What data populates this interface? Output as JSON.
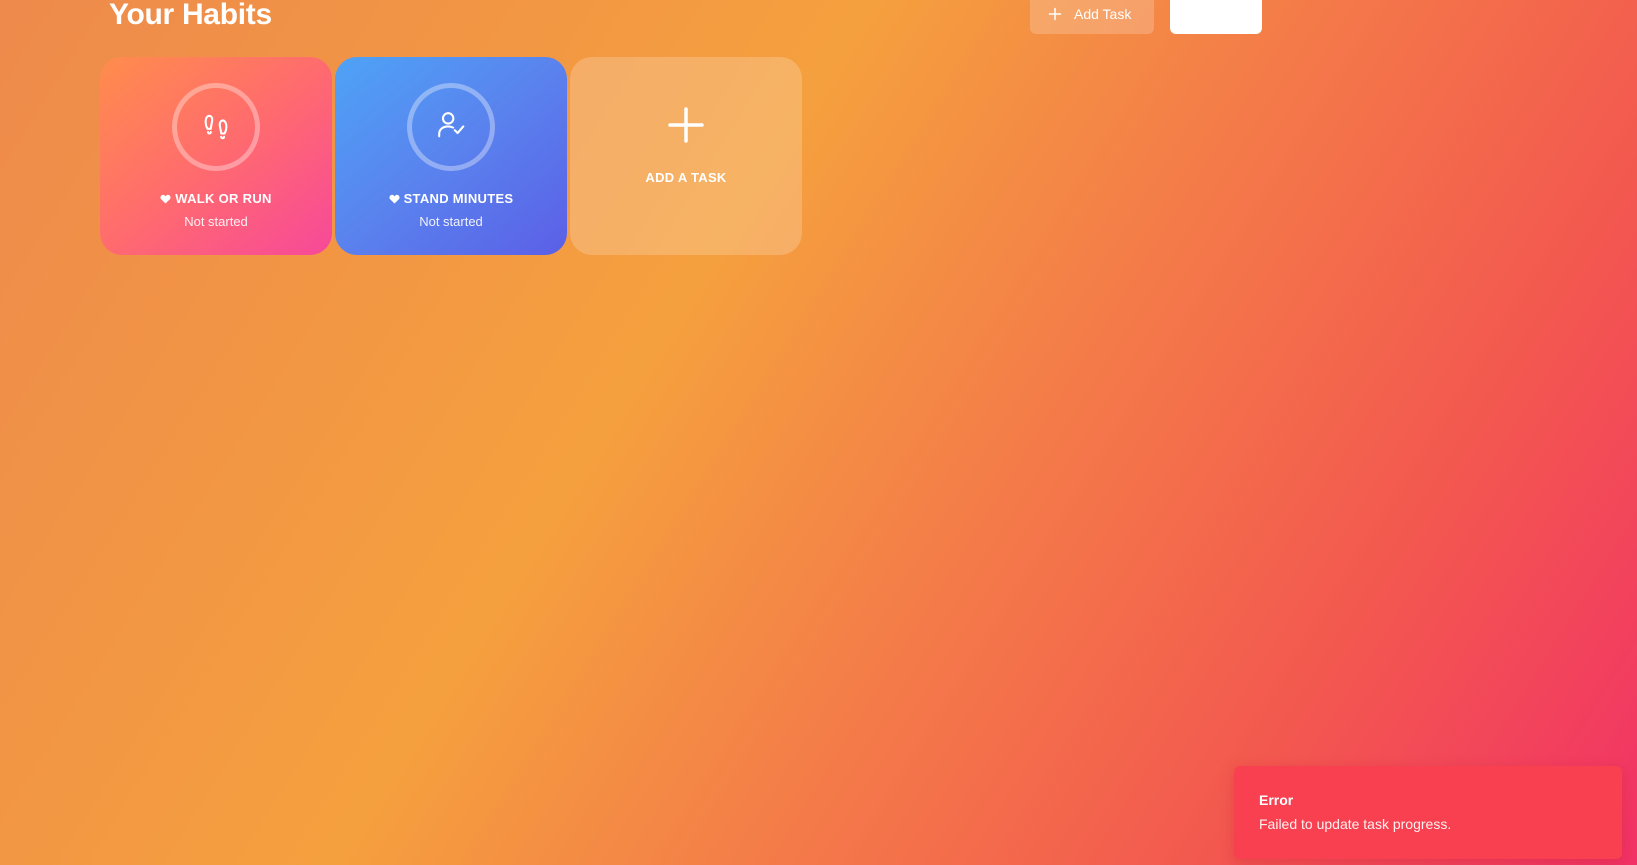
{
  "header": {
    "title": "Your Habits",
    "add_task_label": "Add Task",
    "add_task_icon": "plus-icon",
    "secondary_button_label": ""
  },
  "cards": [
    {
      "title": "WALK OR RUN",
      "status": "Not started",
      "icon": "footprints-icon",
      "badge_icon": "heart-icon",
      "color_start": "#ff8d4c",
      "color_end": "#f7489a"
    },
    {
      "title": "STAND MINUTES",
      "status": "Not started",
      "icon": "user-check-icon",
      "badge_icon": "heart-icon",
      "color_start": "#4ea3f6",
      "color_end": "#5b5fe6"
    }
  ],
  "add_card": {
    "title": "ADD A TASK",
    "icon": "plus-icon"
  },
  "toast": {
    "title": "Error",
    "message": "Failed to update task progress.",
    "color": "#f84050"
  }
}
